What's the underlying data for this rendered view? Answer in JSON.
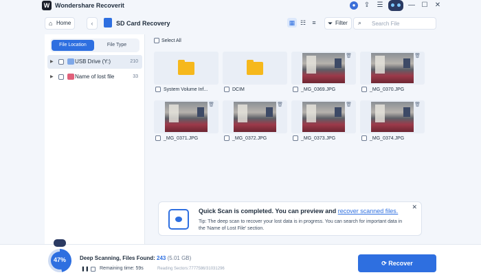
{
  "app": {
    "title": "Wondershare Recoverit",
    "logo_glyph": "W"
  },
  "window_controls": [
    "user-icon",
    "upload-icon",
    "menu-icon",
    "minimize-icon",
    "maximize-icon",
    "close-icon"
  ],
  "nav": {
    "home_label": "Home",
    "back_glyph": "‹",
    "page_title": "SD Card Recovery",
    "filter_label": "Filter",
    "search_placeholder": "Search File"
  },
  "sidebar": {
    "tabs": [
      {
        "label": "File Location",
        "active": true
      },
      {
        "label": "File Type",
        "active": false
      }
    ],
    "tree": [
      {
        "label": "USB Drive (Y:)",
        "count": "210",
        "selected": true,
        "icon_color": "#7fa8e8"
      },
      {
        "label": "Name of lost file",
        "count": "33",
        "selected": false,
        "icon_color": "#e0607a"
      }
    ]
  },
  "main": {
    "select_all_label": "Select All",
    "tiles": [
      {
        "name": "System Volume Inf...",
        "kind": "folder"
      },
      {
        "name": "DCIM",
        "kind": "folder"
      },
      {
        "name": "_MG_0369.JPG",
        "kind": "photo"
      },
      {
        "name": "_MG_0370.JPG",
        "kind": "photo"
      },
      {
        "name": "_MG_0371.JPG",
        "kind": "photo"
      },
      {
        "name": "_MG_0372.JPG",
        "kind": "photo"
      },
      {
        "name": "_MG_0373.JPG",
        "kind": "photo"
      },
      {
        "name": "_MG_0374.JPG",
        "kind": "photo"
      }
    ]
  },
  "notification": {
    "title": "Quick Scan is completed. You can preview and",
    "link": "recover scanned files.",
    "tip": "Tip: The deep scan to recover your lost data is in progress. You can search for important data in the 'Name of Lost File' section."
  },
  "bottom": {
    "progress": "47%",
    "progress_fraction": 0.47,
    "scan_label": "Deep Scanning, Files Found:",
    "files_found": "243",
    "files_size": "(5.01 GB)",
    "remaining": "Remaining time:  59s",
    "sectors": "Reading Sectors:7777586/31031296",
    "recover_label": "Recover"
  },
  "colors": {
    "accent": "#2e6fe0",
    "folder": "#f6b81c"
  }
}
